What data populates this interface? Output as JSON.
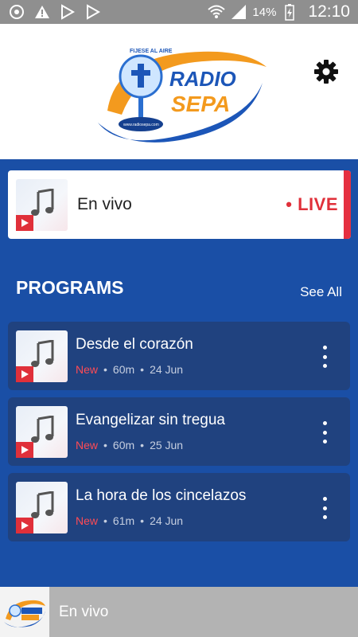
{
  "status_bar": {
    "battery": "14%",
    "time": "12:10"
  },
  "header": {
    "logo_text": "RADIO SEPA",
    "logo_arc_text": "FIJESE AL AIRE",
    "logo_url_text": "www.radiosepa.com"
  },
  "live": {
    "title": "En vivo",
    "badge": "• LIVE"
  },
  "programs": {
    "heading": "PROGRAMS",
    "see_all": "See All",
    "items": [
      {
        "title": "Desde el corazón",
        "tag": "New",
        "duration": "60m",
        "date": "24 Jun"
      },
      {
        "title": "Evangelizar sin tregua",
        "tag": "New",
        "duration": "60m",
        "date": "25 Jun"
      },
      {
        "title": "La hora de los cincelazos",
        "tag": "New",
        "duration": "61m",
        "date": "24 Jun"
      }
    ]
  },
  "player": {
    "title": "En vivo"
  },
  "colors": {
    "background": "#1a4fa6",
    "card": "#20427f",
    "accent_red": "#e0303a"
  }
}
